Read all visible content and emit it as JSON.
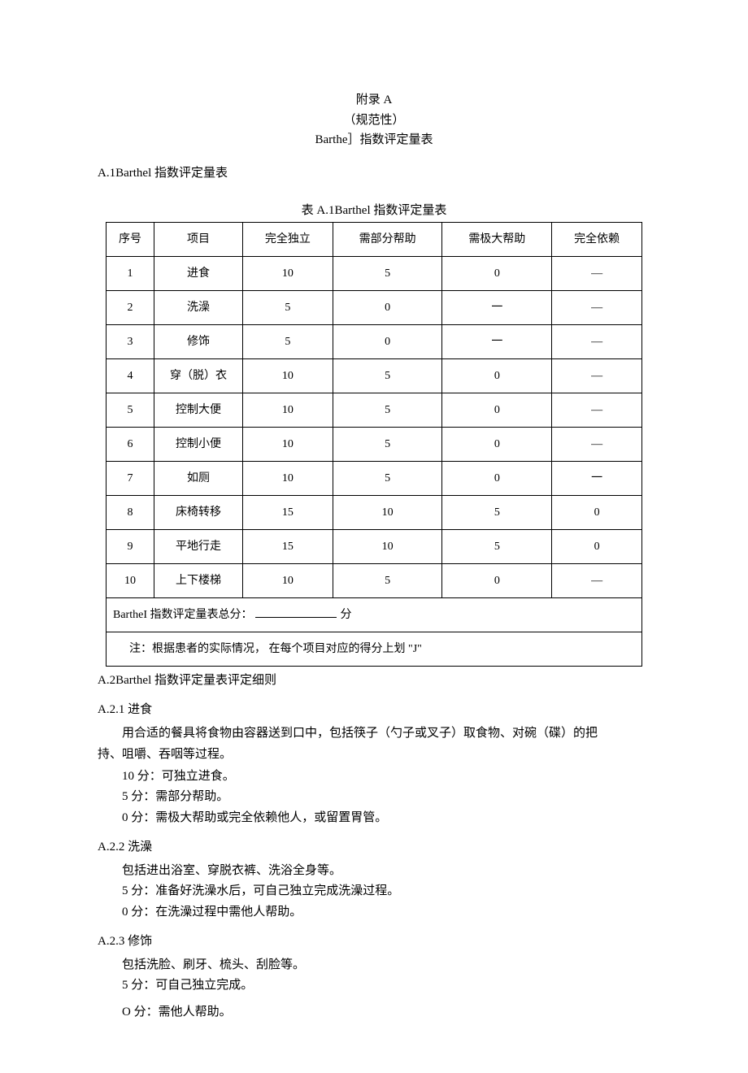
{
  "header": {
    "line1": "附录 A",
    "line2": "（规范性）",
    "line3": "Barthe］指数评定量表"
  },
  "sectionA1": "A.1Barthel 指数评定量表",
  "tableCaption": "表 A.1Barthel 指数评定量表",
  "table": {
    "headers": [
      "序号",
      "项目",
      "完全独立",
      "需部分帮助",
      "需极大帮助",
      "完全依赖"
    ],
    "rows": [
      {
        "seq": "1",
        "item": "进食",
        "c1": "10",
        "c2": "5",
        "c3": "0",
        "c4": "—"
      },
      {
        "seq": "2",
        "item": "洗澡",
        "c1": "5",
        "c2": "0",
        "c3": "一",
        "c4": "—"
      },
      {
        "seq": "3",
        "item": "修饰",
        "c1": "5",
        "c2": "0",
        "c3": "一",
        "c4": "—"
      },
      {
        "seq": "4",
        "item": "穿（脱）衣",
        "c1": "10",
        "c2": "5",
        "c3": "0",
        "c4": "—"
      },
      {
        "seq": "5",
        "item": "控制大便",
        "c1": "10",
        "c2": "5",
        "c3": "0",
        "c4": "—"
      },
      {
        "seq": "6",
        "item": "控制小便",
        "c1": "10",
        "c2": "5",
        "c3": "0",
        "c4": "—"
      },
      {
        "seq": "7",
        "item": "如厕",
        "c1": "10",
        "c2": "5",
        "c3": "0",
        "c4": "一"
      },
      {
        "seq": "8",
        "item": "床椅转移",
        "c1": "15",
        "c2": "10",
        "c3": "5",
        "c4": "0"
      },
      {
        "seq": "9",
        "item": "平地行走",
        "c1": "15",
        "c2": "10",
        "c3": "5",
        "c4": "0"
      },
      {
        "seq": "10",
        "item": "上下楼梯",
        "c1": "10",
        "c2": "5",
        "c3": "0",
        "c4": "—"
      }
    ],
    "footer1_left": "BartheI 指数评定量表总分：",
    "footer1_right": "分",
    "footer2": "注：根据患者的实际情况，   在每个项目对应的得分上划 \"J\""
  },
  "sectionA2": "A.2Barthel 指数评定量表评定细则",
  "a21": {
    "heading": "A.2.1 进食",
    "p1": "用合适的餐具将食物由容器送到口中，包括筷子（勺子或叉子）取食物、对碗（碟）的把",
    "p1cont": "持、咀嚼、吞咽等过程。",
    "s10": "10 分：可独立进食。",
    "s5": "5 分：需部分帮助。",
    "s0": "0 分：需极大帮助或完全依赖他人，或留置胃管。"
  },
  "a22": {
    "heading": "A.2.2 洗澡",
    "p1": "包括进出浴室、穿脱衣裤、洗浴全身等。",
    "s5": "5 分：准备好洗澡水后，可自己独立完成洗澡过程。",
    "s0": "0 分：在洗澡过程中需他人帮助。"
  },
  "a23": {
    "heading": "A.2.3 修饰",
    "p1": "包括洗脸、刷牙、梳头、刮脸等。",
    "s5": "5 分：可自己独立完成。",
    "s0": "O 分：需他人帮助。"
  }
}
